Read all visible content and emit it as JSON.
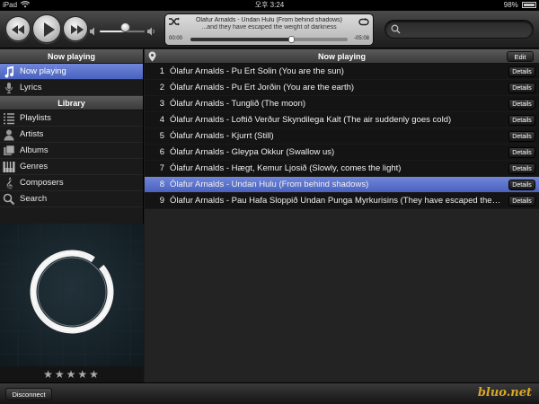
{
  "status": {
    "device": "iPad",
    "time": "오후 3:24",
    "battery": "98%",
    "battery_level": 0.98
  },
  "player": {
    "song_line1": "Ólafur Arnalds - Undan Hulu (From behind shadows)",
    "song_line2": "...and they have escaped the weight of darkness",
    "elapsed": "00:00",
    "remaining": "-05:08",
    "progress": 0.64,
    "volume": 0.55
  },
  "search": {
    "placeholder": ""
  },
  "sidebar": {
    "now_playing_header": "Now playing",
    "top_items": [
      {
        "label": "Now playing",
        "icon": "music-note-icon"
      },
      {
        "label": "Lyrics",
        "icon": "microphone-icon"
      }
    ],
    "library_header": "Library",
    "library_items": [
      {
        "label": "Playlists",
        "icon": "playlist-icon"
      },
      {
        "label": "Artists",
        "icon": "person-icon"
      },
      {
        "label": "Albums",
        "icon": "album-icon"
      },
      {
        "label": "Genres",
        "icon": "piano-icon"
      },
      {
        "label": "Composers",
        "icon": "treble-clef-icon"
      },
      {
        "label": "Search",
        "icon": "search-icon"
      }
    ],
    "rating_stars": 5
  },
  "main": {
    "header": "Now playing",
    "edit_label": "Edit",
    "details_label": "Details",
    "active_index": 7,
    "tracks": [
      {
        "num": "1",
        "title": "Ólafur Arnalds - Pu Ert Solin (You are the sun)"
      },
      {
        "num": "2",
        "title": "Ólafur Arnalds - Pu Ert Jorðin (You are the earth)"
      },
      {
        "num": "3",
        "title": "Ólafur Arnalds - Tunglið (The moon)"
      },
      {
        "num": "4",
        "title": "Ólafur Arnalds - Loftið Verður Skyndilega Kalt (The air suddenly goes cold)"
      },
      {
        "num": "5",
        "title": "Ólafur Arnalds - Kjurrt (Still)"
      },
      {
        "num": "6",
        "title": "Ólafur Arnalds - Gleypa Okkur (Swallow us)"
      },
      {
        "num": "7",
        "title": "Ólafur Arnalds - Hægt, Kemur Ljosið (Slowly, comes the light)"
      },
      {
        "num": "8",
        "title": "Ólafur Arnalds - Undan Hulu (From behind shadows)"
      },
      {
        "num": "9",
        "title": "Ólafur Arnalds - Pau Hafa Sloppið Undan Punga Myrkurisins (They have escaped the weight of darkness)"
      }
    ]
  },
  "bottom": {
    "disconnect_label": "Disconnect",
    "watermark": "bluo.net"
  },
  "colors": {
    "accent": "#5a72cf",
    "watermark": "#d9a825"
  }
}
